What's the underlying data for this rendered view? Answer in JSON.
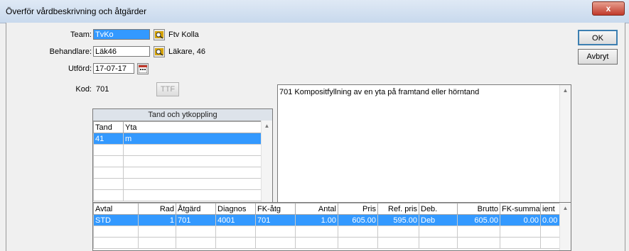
{
  "window": {
    "title": "Överför vårdbeskrivning och åtgärder",
    "close": "x"
  },
  "form": {
    "team_label": "Team:",
    "team_value": "TvKo",
    "team_name": "Ftv Kolla",
    "behandlare_label": "Behandlare:",
    "behandlare_value": "Läk46",
    "behandlare_name": "Läkare, 46",
    "utford_label": "Utförd:",
    "utford_value": "17-07-17",
    "kod_label": "Kod:",
    "kod_value": "701",
    "ttf_label": "TTF"
  },
  "buttons": {
    "ok": "OK",
    "cancel": "Avbryt"
  },
  "description": "701 Kompositfyllning av en yta på framtand eller hörntand",
  "tooth_panel": {
    "title": "Tand och ytkoppling",
    "headers": [
      "Tand",
      "Yta"
    ],
    "rows": [
      [
        "41",
        "m"
      ],
      [
        "",
        ""
      ],
      [
        "",
        ""
      ],
      [
        "",
        ""
      ],
      [
        "",
        ""
      ],
      [
        "",
        ""
      ]
    ]
  },
  "actions_grid": {
    "headers": [
      "Avtal",
      "Rad",
      "Åtgärd",
      "Diagnos",
      "FK-åtg",
      "Antal",
      "Pris",
      "Ref. pris",
      "Deb.",
      "Brutto",
      "FK-summa",
      "ient"
    ],
    "rows": [
      [
        "STD",
        "1",
        "701",
        "4001",
        "701",
        "1.00",
        "605.00",
        "595.00",
        "Deb",
        "605.00",
        "0.00",
        "0.00"
      ],
      [
        "",
        "",
        "",
        "",
        "",
        "",
        "",
        "",
        "",
        "",
        "",
        ""
      ],
      [
        "",
        "",
        "",
        "",
        "",
        "",
        "",
        "",
        "",
        "",
        "",
        ""
      ]
    ]
  }
}
